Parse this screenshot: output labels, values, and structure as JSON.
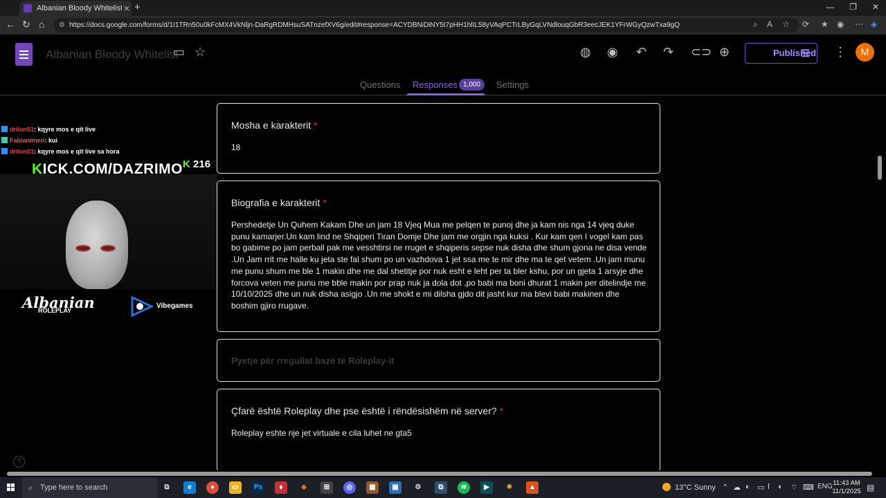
{
  "browser": {
    "tab_title": "Albanian Bloody Whitelist - Goog",
    "url": "https://docs.google.com/forms/d/1I1TRn50u0kFcMX4VkNljn-DaRgRDMHsuSATnzefXV6g/edit#response=ACYDBNiDiNY5t7pHH1hlIL58yVAqPCTrLByGqLVNdlouqGbR3eecJEK1YFrWGyQzwTxa9gQ"
  },
  "form": {
    "title": "Albanian Bloody Whitelist",
    "published_label": "Published",
    "avatar_letter": "M",
    "tabs": {
      "questions": "Questions",
      "responses": "Responses",
      "settings": "Settings"
    },
    "responses_count": "1,000"
  },
  "cards": {
    "age": {
      "question": "Mosha e karakterit",
      "required": "*",
      "answer": "18"
    },
    "bio": {
      "question": "Biografia e karakterit",
      "required": "*",
      "answer_lines": [
        "Pershedetje Un Quhem Kakam Dhe un jam 18 Vjeq Mua me pelqen te punoj dhe ja kam nis nga 14 vjeq duke",
        "punu kamarjer.Un kam lind ne Shqiperi Tiran Domje Dhe jam me orgjin nga kuksi . Kur kam qen I vogel kam pas",
        "bo gabime po jam perball pak me vesshtirsi ne rruget e shqiperis sepse nuk disha dhe shum gjona ne disa vende",
        ".Un Jam rrit me halle ku jeta ste fal shum po un vazhdova 1 jet ssa me te mir dhe ma te qet vetem .Un jam munu",
        "me punu shum me ble 1 makin dhe me dal shetitje por nuk esht e leht per ta bler kshu, por un gjeta 1 arsyje dhe",
        "forcova veten me punu me bble makin por prap nuk ja dola dot ,po babi ma boni dhurat 1 makin per ditelindje me",
        "10/10/2025 dhe un nuk disha asigjo .Un me shokt e mi dilsha gjdo dit jasht kur ma blevi babi makinen dhe",
        "boshim gjiro rrugave."
      ]
    },
    "section": {
      "title": "Pyetje për rregullat bazë të Roleplay-it"
    },
    "roleplay": {
      "question": "Çfarë është Roleplay dhe pse është i rëndësishëm në server?",
      "required": "*",
      "answer": "Roleplay eshte nje jet virtuale e cila luhet ne gta5"
    }
  },
  "stream": {
    "chat": [
      {
        "user": "drilon01",
        "message": ": kqyre mos e qit live"
      },
      {
        "user": "Fabianimeri",
        "message": ": kui"
      },
      {
        "user": "drilon01",
        "message": ": kqyre mos e qit live sa hora"
      }
    ],
    "kick_url": "ICK.COM/DAZRIMO",
    "kick_count": "216",
    "logo_text": "Albanian",
    "logo_sub": "ROLEPLAY",
    "vibe_label": "Vibegames"
  },
  "taskbar": {
    "search_placeholder": "Type here to search",
    "weather": "13°C  Sunny",
    "language": "ENG",
    "time": "11:43 AM",
    "date": "11/1/2025"
  },
  "colors": {
    "accent_purple": "#8a62d9",
    "required_red": "#d93025",
    "kick_green": "#53fc18",
    "avatar_orange": "#e8710a"
  }
}
